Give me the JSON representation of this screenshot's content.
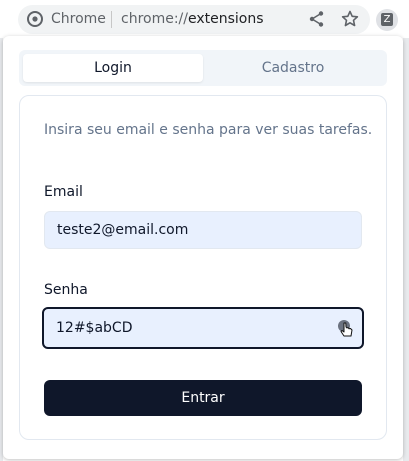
{
  "browser": {
    "site_name": "Chrome",
    "url_scheme": "chrome://",
    "url_host": "extensions",
    "extension_badge": "Z"
  },
  "tabs": {
    "login": "Login",
    "cadastro": "Cadastro",
    "active": "login"
  },
  "form": {
    "description": "Insira seu email e senha para ver suas tarefas.",
    "email_label": "Email",
    "email_value": "teste2@email.com",
    "password_label": "Senha",
    "password_value": "12#$abCD",
    "submit_label": "Entrar"
  },
  "colors": {
    "primary": "#0f172a",
    "input_bg": "#e8f0fe",
    "muted_text": "#64748b"
  }
}
